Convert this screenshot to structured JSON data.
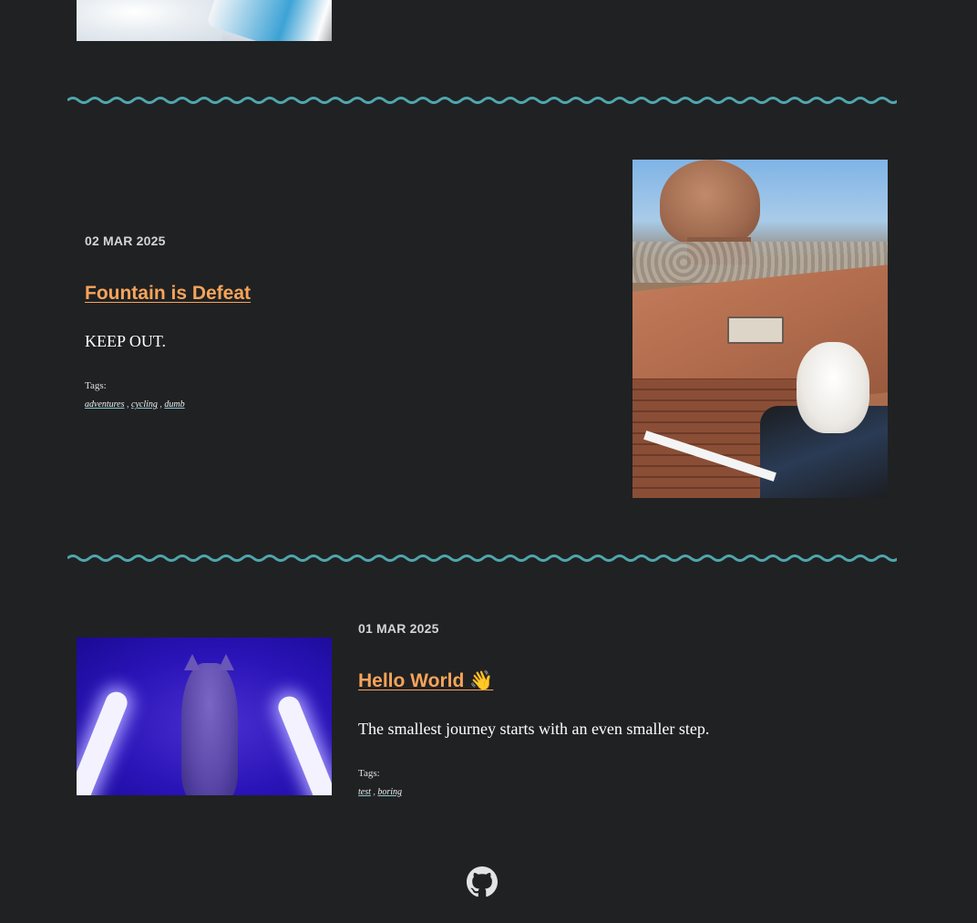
{
  "posts": [
    {
      "date": "02 MAR 2025",
      "title": "Fountain is Defeat",
      "excerpt": "KEEP OUT.",
      "tags_label": "Tags:",
      "tags": [
        "adventures",
        "cycling",
        "dumb"
      ]
    },
    {
      "date": "01 MAR 2025",
      "title": "Hello World 👋",
      "excerpt": "The smallest journey starts with an even smaller step.",
      "tags_label": "Tags:",
      "tags": [
        "test",
        "boring"
      ]
    }
  ],
  "separator": ",",
  "footer": {
    "icon": "github-icon"
  },
  "colors": {
    "background": "#202122",
    "title": "#f6a45a",
    "divider": "#4fa6ad",
    "text": "#ffffff"
  }
}
